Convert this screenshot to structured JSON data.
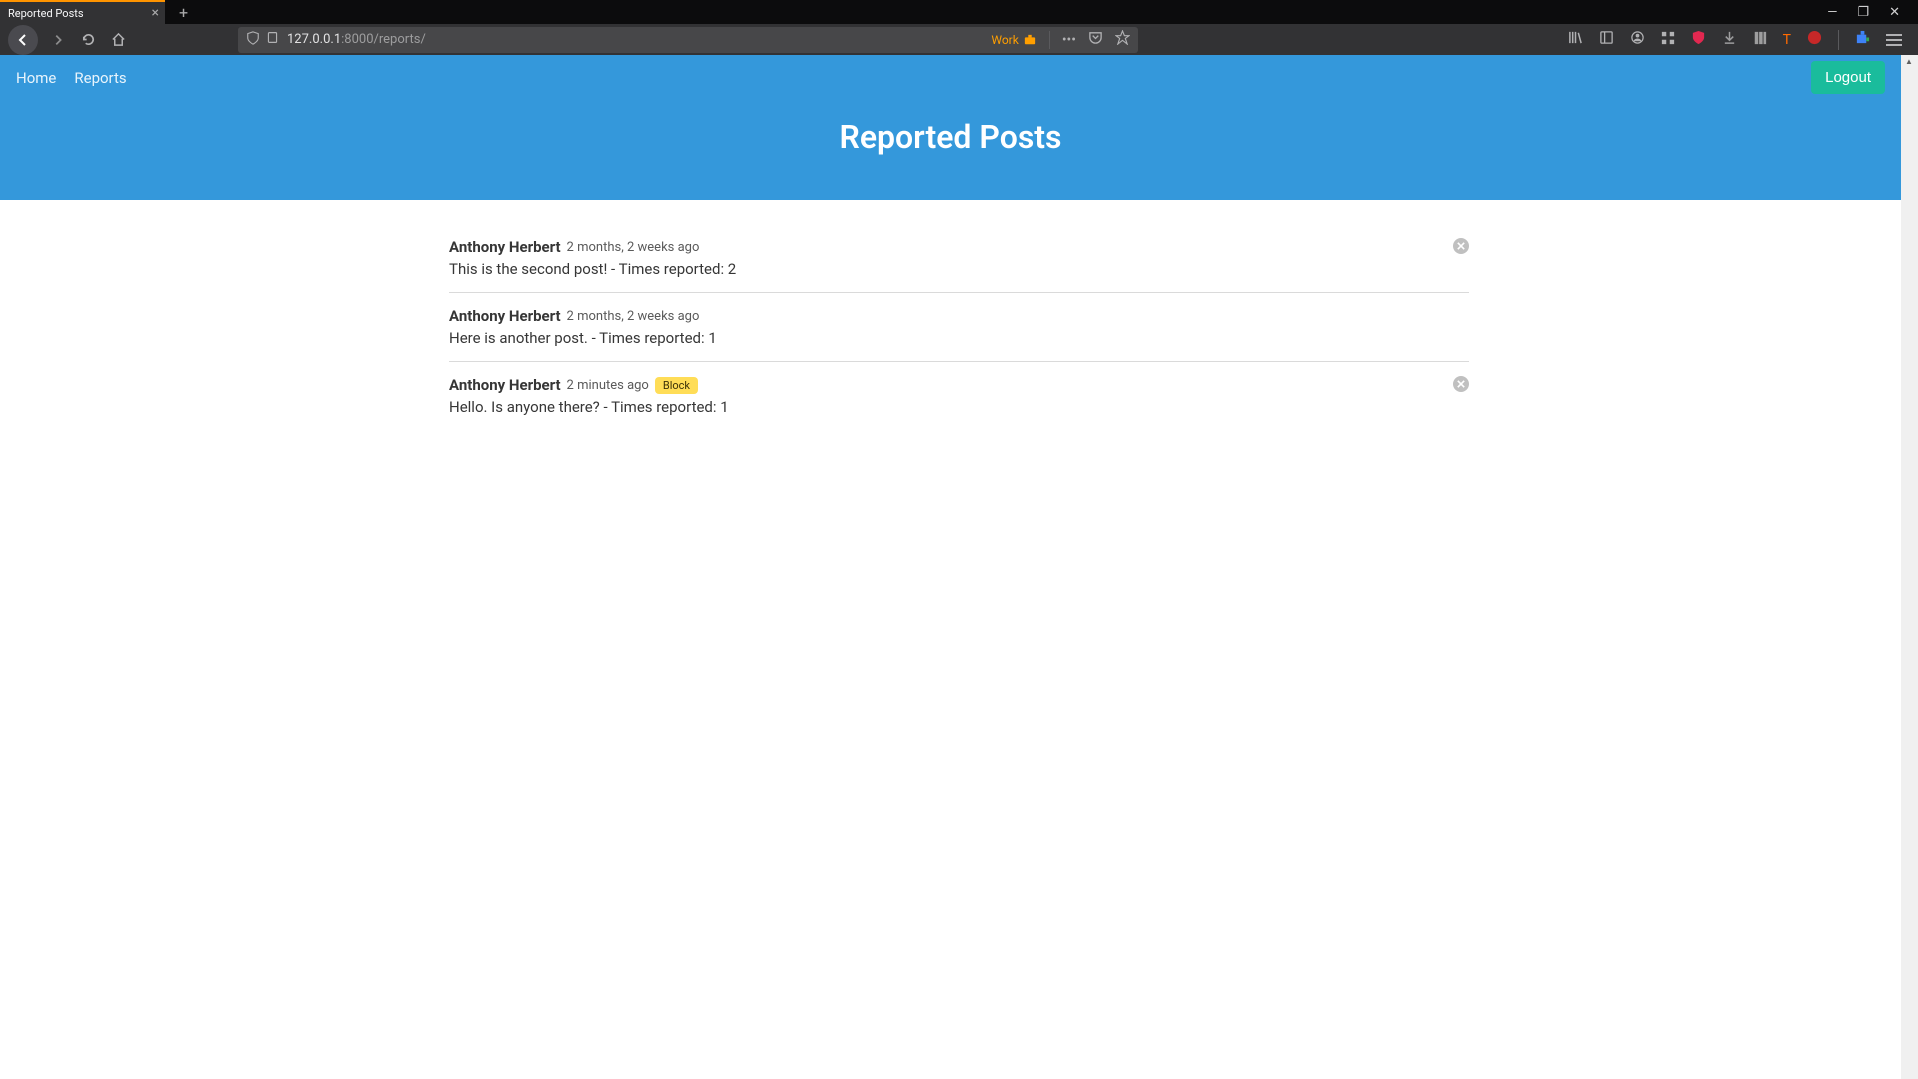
{
  "browser": {
    "tab_title": "Reported Posts",
    "url_host": "127.0.0.1",
    "url_port": ":8000",
    "url_path": "/reports/",
    "work_label": "Work"
  },
  "navbar": {
    "home": "Home",
    "reports": "Reports",
    "logout": "Logout"
  },
  "page_title": "Reported Posts",
  "posts": [
    {
      "author": "Anthony Herbert",
      "timeago": "2 months, 2 weeks ago",
      "body": "This is the second post! - Times reported: 2",
      "has_block": false,
      "has_dismiss": true
    },
    {
      "author": "Anthony Herbert",
      "timeago": "2 months, 2 weeks ago",
      "body": "Here is another post. - Times reported: 1",
      "has_block": false,
      "has_dismiss": false
    },
    {
      "author": "Anthony Herbert",
      "timeago": "2 minutes ago",
      "body": "Hello. Is anyone there? - Times reported: 1",
      "has_block": true,
      "block_label": "Block",
      "has_dismiss": true
    }
  ]
}
